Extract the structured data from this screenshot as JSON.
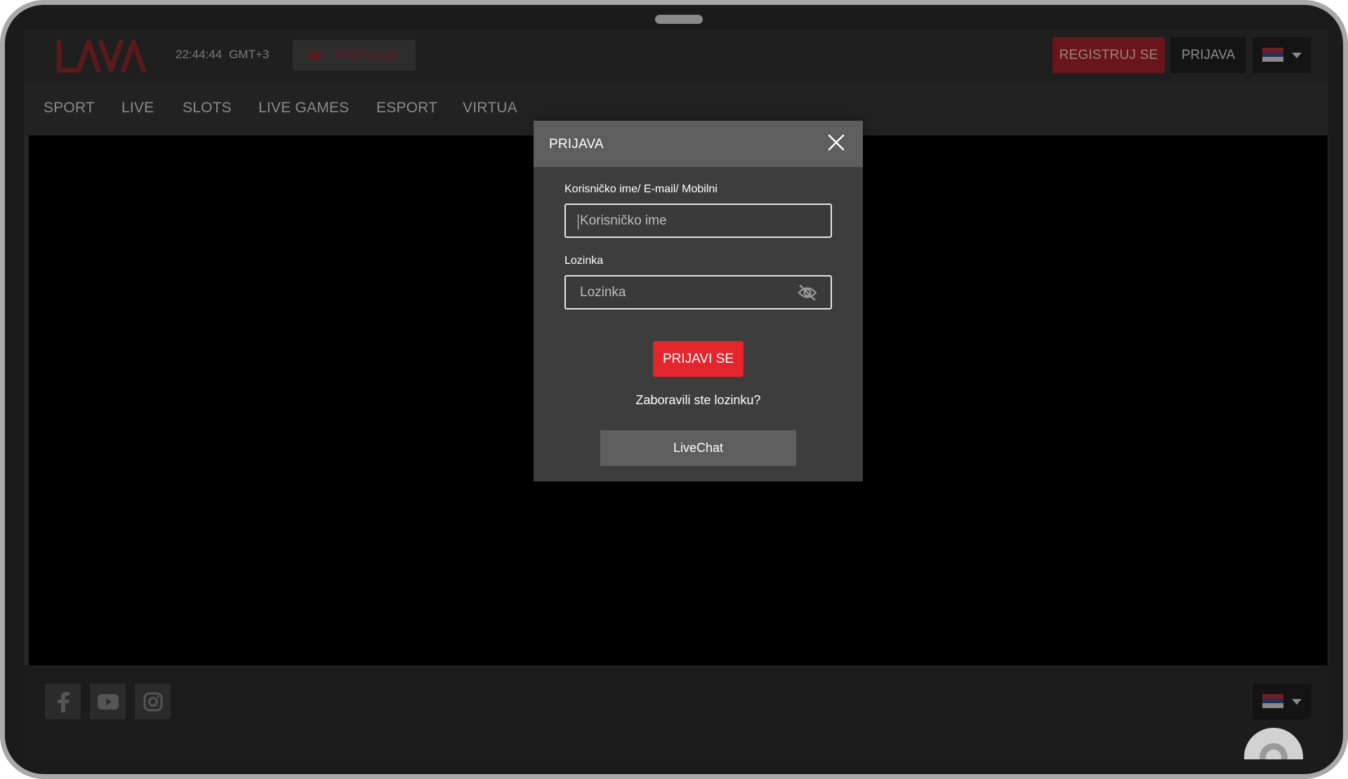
{
  "header": {
    "logo_text": "LAVA",
    "time": "22:44:44",
    "timezone": "GMT+3",
    "promo_label": "Promocije",
    "register_label": "REGISTRUJ SE",
    "login_label": "PRIJAVA",
    "language_flag": "serbia-flag-icon"
  },
  "nav": {
    "items": [
      {
        "label": "SPORT"
      },
      {
        "label": "LIVE"
      },
      {
        "label": "SLOTS"
      },
      {
        "label": "LIVE GAMES"
      },
      {
        "label": "ESPORT"
      },
      {
        "label": "VIRTUA"
      }
    ]
  },
  "modal": {
    "title": "PRIJAVA",
    "username_label": "Korisničko ime/ E-mail/ Mobilni",
    "username_placeholder": "Korisničko ime",
    "password_label": "Lozinka",
    "password_placeholder": "Lozinka",
    "submit_label": "PRIJAVI SE",
    "forgot_label": "Zaboravili ste lozinku?",
    "livechat_label": "LiveChat"
  },
  "footer": {
    "social": [
      "facebook-icon",
      "youtube-icon",
      "instagram-icon"
    ]
  },
  "colors": {
    "accent_red": "#e3252c",
    "overlay_dark": "#1f1f1f",
    "modal_bg": "#3d3d3d",
    "modal_header": "#5e5e5e"
  }
}
